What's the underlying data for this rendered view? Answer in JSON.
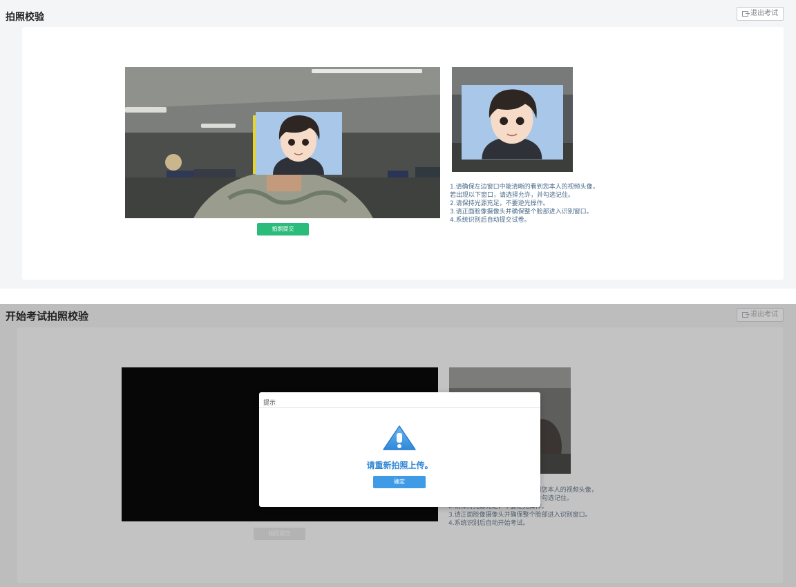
{
  "top": {
    "title": "拍照校验",
    "exit_label": "退出考试",
    "submit_label": "拍照提交",
    "instructions": [
      "1.请确保左边窗口中能清晰的看到您本人的视频头像，",
      "若出现以下窗口，请选择允许，并勾选记住。",
      "2.请保持光源充足，不要逆光操作。",
      "3.请正面脸像摄像头并确保整个脸部进入识别窗口。",
      "4.系统识别后自动提交试卷。"
    ]
  },
  "bottom": {
    "title": "开始考试拍照校验",
    "exit_label": "退出考试",
    "submit_label": "拍照提交",
    "instructions": [
      "1.请确保左边窗口中能清晰的看到您本人的视频头像，",
      "若出现以下窗口，请选择允许，并勾选记住。",
      "2.请保持光源充足，不要逆光操作。",
      "3.请正面脸像摄像头并确保整个脸部进入识别窗口。",
      "4.系统识别后自动开始考试。"
    ],
    "dialog": {
      "title": "提示",
      "message": "请重新拍照上传。",
      "ok_label": "确定"
    }
  },
  "colors": {
    "green_button": "#2bbb7a",
    "blue_button": "#3f9be6",
    "dialog_message": "#2f86d6",
    "warning_icon": "#3f9be6"
  }
}
